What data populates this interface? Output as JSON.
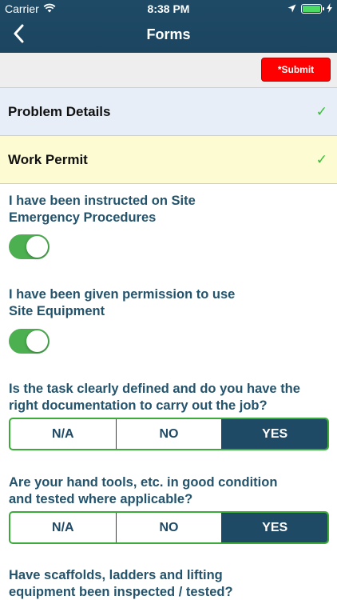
{
  "status_bar": {
    "carrier": "Carrier",
    "time": "8:38 PM",
    "icons": [
      "wifi-icon",
      "location-icon",
      "battery-icon",
      "charging-icon"
    ]
  },
  "nav": {
    "title": "Forms",
    "back_icon": "chevron-left-icon"
  },
  "toolbar": {
    "submit_label": "*Submit"
  },
  "sections": [
    {
      "label": "Problem Details",
      "check": "✓",
      "background": "#e8eef8"
    },
    {
      "label": "Work Permit",
      "check": "✓",
      "background": "#fdfbd2"
    }
  ],
  "questions": [
    {
      "text": "I have been instructed on Site Emergency Procedures",
      "type": "toggle",
      "value": true
    },
    {
      "text": "I have been given permission to use Site Equipment",
      "type": "toggle",
      "value": true
    },
    {
      "text": "Is the task clearly defined and do you have the right documentation to carry out the job?",
      "type": "segmented",
      "options": [
        "N/A",
        "NO",
        "YES"
      ],
      "selected": "YES"
    },
    {
      "text": "Are your hand tools, etc. in good condition and tested where applicable?",
      "type": "segmented",
      "options": [
        "N/A",
        "NO",
        "YES"
      ],
      "selected": "YES"
    },
    {
      "text": "Have scaffolds, ladders and lifting equipment been inspected / tested?",
      "type": "segmented"
    }
  ],
  "colors": {
    "header": "#1f4a66",
    "question_text": "#24536c",
    "toggle_on": "#4caf50",
    "segment_border": "#3cab3c",
    "segment_selected": "#1f4a66",
    "submit": "#ff0000",
    "check": "#2fbf2f"
  }
}
